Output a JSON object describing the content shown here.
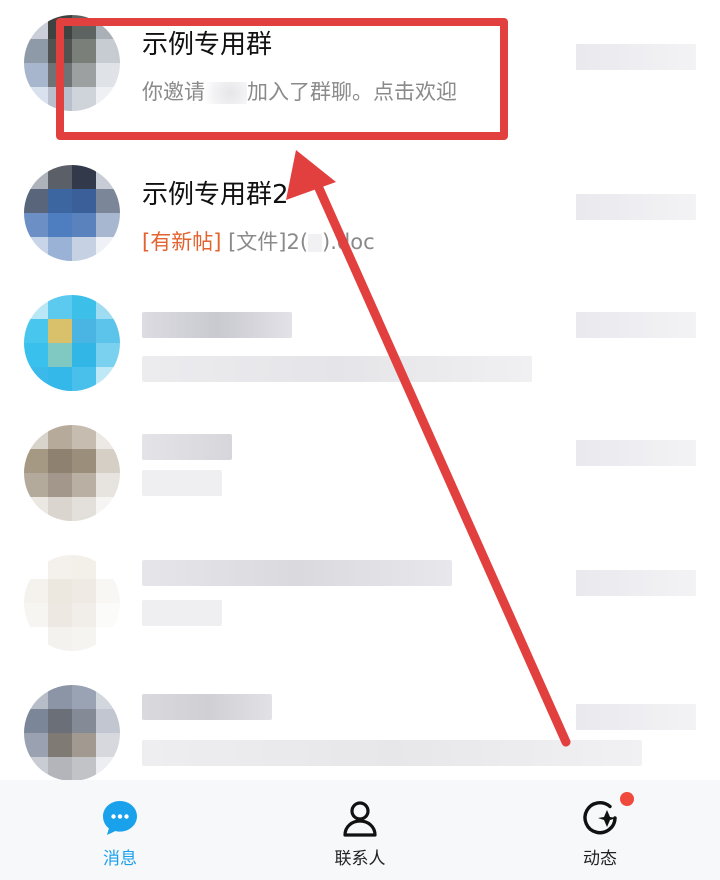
{
  "chat_list": [
    {
      "title": "示例专用群",
      "subtitle": "你邀请",
      "subtitle_tail": "加入了群聊。点击欢迎"
    },
    {
      "title": "示例专用群2",
      "subtitle_tag": "[有新帖]",
      "subtitle": "[文件]2(",
      "subtitle_tail": ").doc"
    }
  ],
  "tabbar": {
    "tabs": [
      {
        "label": "消息",
        "icon": "message-icon",
        "active": true
      },
      {
        "label": "联系人",
        "icon": "contacts-icon",
        "active": false
      },
      {
        "label": "动态",
        "icon": "moments-icon",
        "active": false
      }
    ]
  },
  "colors": {
    "accent": "#1aa1ec",
    "annotation": "#e2403f",
    "tag": "#e2632f",
    "badge": "#ef4a3c"
  }
}
